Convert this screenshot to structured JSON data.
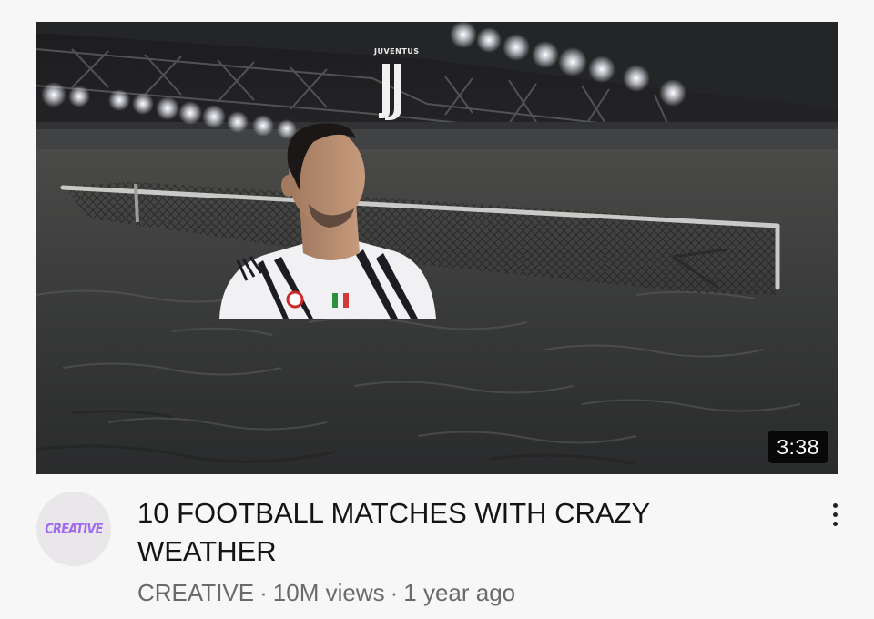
{
  "video": {
    "duration": "3:38",
    "title": "10 FOOTBALL MATCHES WITH CRAZY WEATHER",
    "channel": "CREATIVE",
    "views": "10M views",
    "age": "1 year ago",
    "separator": "·"
  },
  "avatar": {
    "text": "CREATIVE",
    "color": "#a06bf0"
  },
  "thumbnail": {
    "logo_text": "JUVENTUS",
    "scene": "flooded football stadium with player standing in water near goal",
    "icons": [
      "juventus-logo-icon",
      "floodlight-icon",
      "goal-net-icon"
    ]
  },
  "menu": {
    "icon": "more-vertical-icon"
  },
  "colors": {
    "background": "#f7f7f7",
    "title_text": "#141414",
    "meta_text": "#6a6a6a",
    "badge_bg": "#000000"
  }
}
